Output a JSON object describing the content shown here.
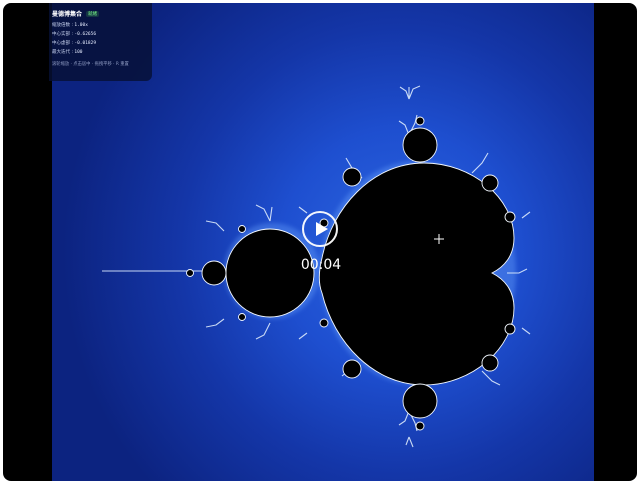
{
  "panel": {
    "title": "曼德博集合",
    "status": "就绪",
    "zoom_label": "缩放倍数",
    "zoom_value": "1.00x",
    "center_re_label": "中心实部",
    "center_re_value": "-0.62656",
    "center_im_label": "中心虚部",
    "center_im_value": "-0.01829",
    "iter_label": "最大迭代",
    "iter_value": "100",
    "hint": "滚轮缩放 · 点击居中 · 拖拽平移 · R 重置"
  },
  "player": {
    "time": "00:04",
    "play_icon": "play-icon"
  },
  "colors": {
    "background_dark": "#0c2380",
    "background_glow": "#2d66e0",
    "set_fill": "#000000",
    "edge_glow": "#eaf6ff"
  }
}
